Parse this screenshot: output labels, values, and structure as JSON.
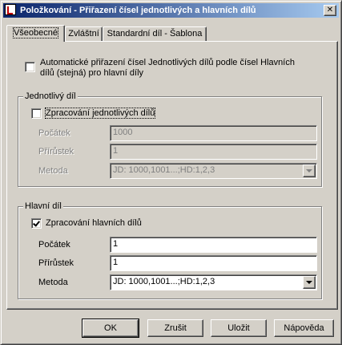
{
  "window": {
    "title": "Položkování - Přiřazení čísel jednotlivých a hlavních dílů",
    "close_glyph": "✕"
  },
  "tabs": [
    {
      "label": "Všeobecné",
      "active": true
    },
    {
      "label": "Zvláštní",
      "active": false
    },
    {
      "label": "Standardní díl - Šablona",
      "active": false
    }
  ],
  "auto_assign": {
    "checked": false,
    "label": "Automatické přiřazení čísel Jednotlivých dílů podle čísel Hlavních dílů (stejná) pro hlavní díly"
  },
  "single_part": {
    "group_label": "Jednotlivý díl",
    "process": {
      "checked": false,
      "label": "Zpracování jednotlivých dílů"
    },
    "start": {
      "label": "Počátek",
      "value": "1000",
      "enabled": false
    },
    "increment": {
      "label": "Přírůstek",
      "value": "1",
      "enabled": false
    },
    "method": {
      "label": "Metoda",
      "value": "JD: 1000,1001...;HD:1,2,3",
      "enabled": false
    }
  },
  "main_part": {
    "group_label": "Hlavní díl",
    "process": {
      "checked": true,
      "label": "Zpracování hlavních dílů"
    },
    "start": {
      "label": "Počátek",
      "value": "1",
      "enabled": true
    },
    "increment": {
      "label": "Přírůstek",
      "value": "1",
      "enabled": true
    },
    "method": {
      "label": "Metoda",
      "value": "JD: 1000,1001...;HD:1,2,3",
      "enabled": true
    }
  },
  "buttons": {
    "ok": "OK",
    "cancel": "Zrušit",
    "save": "Uložit",
    "help": "Nápověda"
  },
  "colors": {
    "face": "#d4d0c8",
    "title_gradient_start": "#0a246a",
    "title_gradient_end": "#a6caf0",
    "disabled_text": "#808080"
  }
}
